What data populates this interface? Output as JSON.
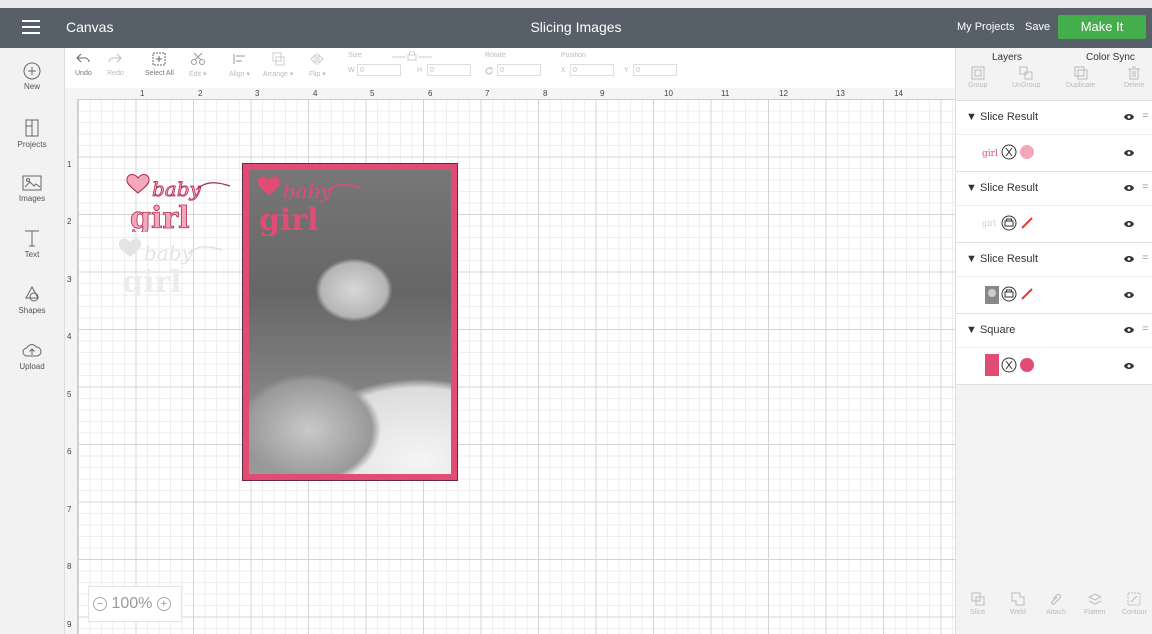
{
  "topbar": {
    "app_name": "Canvas",
    "project_title": "Slicing Images",
    "my_projects": "My Projects",
    "save": "Save",
    "make_it": "Make It"
  },
  "left_nav": [
    {
      "label": "New",
      "icon": "plus-circle-icon"
    },
    {
      "label": "Projects",
      "icon": "projects-icon"
    },
    {
      "label": "Images",
      "icon": "image-icon"
    },
    {
      "label": "Text",
      "icon": "text-icon"
    },
    {
      "label": "Shapes",
      "icon": "shapes-icon"
    },
    {
      "label": "Upload",
      "icon": "upload-cloud-icon"
    }
  ],
  "toolbar": {
    "undo": "Undo",
    "redo": "Redo",
    "select_all": "Select All",
    "edit": "Edit",
    "align": "Align",
    "arrange": "Arrange",
    "flip": "Flip",
    "size_label": "Size",
    "w": "W",
    "h": "H",
    "rotate_label": "Rotate",
    "position_label": "Position",
    "x": "X",
    "y": "Y",
    "w_value": "0",
    "h_value": "0",
    "rotate_value": "0",
    "x_value": "0",
    "y_value": "0"
  },
  "rulers": {
    "top": [
      "1",
      "2",
      "3",
      "4",
      "5",
      "6",
      "7",
      "8",
      "9",
      "10",
      "11",
      "12",
      "13",
      "14"
    ],
    "left": [
      "1",
      "2",
      "3",
      "4",
      "5",
      "6",
      "7",
      "8",
      "9"
    ]
  },
  "zoom": {
    "level": "100%",
    "minus": "−",
    "plus": "+"
  },
  "canvas_art": {
    "sticker_top": {
      "line1": "baby",
      "line2": "girl"
    },
    "sticker_faded": {
      "line1": "baby",
      "line2": "girl"
    },
    "frame_text": {
      "line1": "baby",
      "line2": "girl"
    }
  },
  "right_panel": {
    "tab_layers": "Layers",
    "tab_color_sync": "Color Sync",
    "actions": [
      "Group",
      "UnGroup",
      "Duplicate",
      "Delete"
    ],
    "layers": [
      {
        "name": "Slice Result"
      },
      {
        "name": "Slice Result"
      },
      {
        "name": "Slice Result"
      },
      {
        "name": "Square"
      }
    ],
    "footer": [
      "Slice",
      "Weld",
      "Attach",
      "Flatten",
      "Contour"
    ]
  },
  "colors": {
    "accent_pink": "#e14c74",
    "make_it_green": "#44ad4c",
    "topbar": "#575f68"
  }
}
